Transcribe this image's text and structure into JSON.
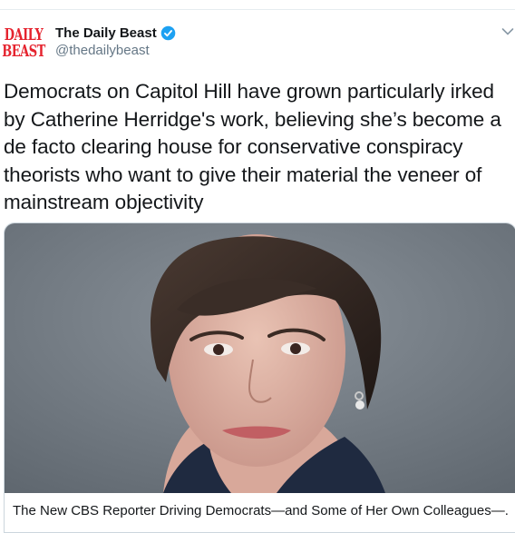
{
  "account": {
    "display_name": "The Daily Beast",
    "handle": "@thedailybeast",
    "logo_lines": [
      "DAILY",
      "BEAST"
    ],
    "verified": true,
    "logo_color": "#e5232e",
    "verified_color": "#1da1f2"
  },
  "tweet": {
    "text_lines": [
      "Democrats on Capitol Hill have grown particularly irked",
      "by Catherine Herridge's work, believing she’s become a",
      "de facto clearing house for conservative conspiracy",
      "theorists who want to give their material the veneer of",
      "mainstream objectivity"
    ]
  },
  "card": {
    "title": "The New CBS Reporter Driving Democrats—and Some of Her Own Colleagues—..."
  },
  "icons": {
    "menu": "chevron-down-icon",
    "verified": "verified-badge-icon"
  }
}
